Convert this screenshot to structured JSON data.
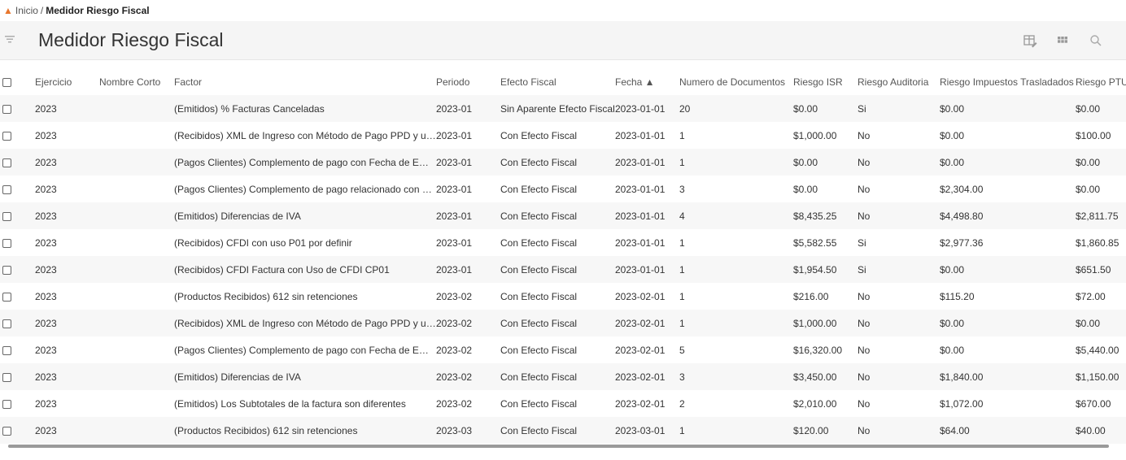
{
  "breadcrumb": {
    "home": "Inicio",
    "separator": "/",
    "current": "Medidor Riesgo Fiscal"
  },
  "header": {
    "title": "Medidor Riesgo Fiscal"
  },
  "table": {
    "columns": [
      "Ejercicio",
      "Nombre Corto",
      "Factor",
      "Periodo",
      "Efecto Fiscal",
      "Fecha ▲",
      "Numero de Documentos",
      "Riesgo ISR",
      "Riesgo Auditoria",
      "Riesgo Impuestos Trasladados",
      "Riesgo PTU"
    ],
    "rows": [
      [
        "2023",
        "",
        "(Emitidos) % Facturas Canceladas",
        "2023-01",
        "Sin Aparente Efecto Fiscal",
        "2023-01-01",
        "20",
        "$0.00",
        "Si",
        "$0.00",
        "$0.00"
      ],
      [
        "2023",
        "",
        "(Recibidos) XML de Ingreso con Método de Pago PPD y una Forma de Pago",
        "2023-01",
        "Con Efecto Fiscal",
        "2023-01-01",
        "1",
        "$1,000.00",
        "No",
        "$0.00",
        "$100.00"
      ],
      [
        "2023",
        "",
        "(Pagos Clientes) Complemento de pago con Fecha de Emisión anterior",
        "2023-01",
        "Con Efecto Fiscal",
        "2023-01-01",
        "1",
        "$0.00",
        "No",
        "$0.00",
        "$0.00"
      ],
      [
        "2023",
        "",
        "(Pagos Clientes) Complemento de pago relacionado con un XML de Ingreso",
        "2023-01",
        "Con Efecto Fiscal",
        "2023-01-01",
        "3",
        "$0.00",
        "No",
        "$2,304.00",
        "$0.00"
      ],
      [
        "2023",
        "",
        "(Emitidos) Diferencias de IVA",
        "2023-01",
        "Con Efecto Fiscal",
        "2023-01-01",
        "4",
        "$8,435.25",
        "No",
        "$4,498.80",
        "$2,811.75"
      ],
      [
        "2023",
        "",
        "(Recibidos) CFDI con uso P01 por definir",
        "2023-01",
        "Con Efecto Fiscal",
        "2023-01-01",
        "1",
        "$5,582.55",
        "Si",
        "$2,977.36",
        "$1,860.85"
      ],
      [
        "2023",
        "",
        "(Recibidos) CFDI Factura con Uso de CFDI CP01",
        "2023-01",
        "Con Efecto Fiscal",
        "2023-01-01",
        "1",
        "$1,954.50",
        "Si",
        "$0.00",
        "$651.50"
      ],
      [
        "2023",
        "",
        "(Productos Recibidos) 612 sin retenciones",
        "2023-02",
        "Con Efecto Fiscal",
        "2023-02-01",
        "1",
        "$216.00",
        "No",
        "$115.20",
        "$72.00"
      ],
      [
        "2023",
        "",
        "(Recibidos) XML de Ingreso con Método de Pago PPD y una Forma de Pago",
        "2023-02",
        "Con Efecto Fiscal",
        "2023-02-01",
        "1",
        "$1,000.00",
        "No",
        "$0.00",
        "$0.00"
      ],
      [
        "2023",
        "",
        "(Pagos Clientes) Complemento de pago con Fecha de Emisión anterior",
        "2023-02",
        "Con Efecto Fiscal",
        "2023-02-01",
        "5",
        "$16,320.00",
        "No",
        "$0.00",
        "$5,440.00"
      ],
      [
        "2023",
        "",
        "(Emitidos) Diferencias de IVA",
        "2023-02",
        "Con Efecto Fiscal",
        "2023-02-01",
        "3",
        "$3,450.00",
        "No",
        "$1,840.00",
        "$1,150.00"
      ],
      [
        "2023",
        "",
        "(Emitidos) Los Subtotales de la factura son diferentes",
        "2023-02",
        "Con Efecto Fiscal",
        "2023-02-01",
        "2",
        "$2,010.00",
        "No",
        "$1,072.00",
        "$670.00"
      ],
      [
        "2023",
        "",
        "(Productos Recibidos) 612 sin retenciones",
        "2023-03",
        "Con Efecto Fiscal",
        "2023-03-01",
        "1",
        "$120.00",
        "No",
        "$64.00",
        "$40.00"
      ]
    ]
  }
}
